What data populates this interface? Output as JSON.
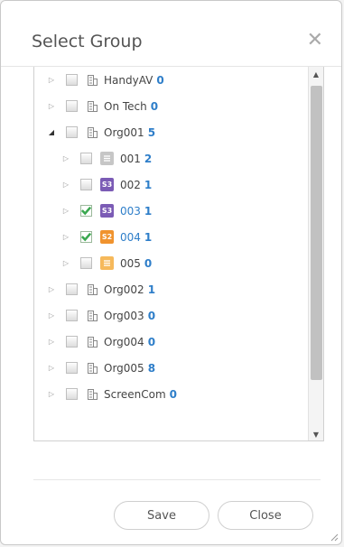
{
  "dialog": {
    "title": "Select Group",
    "close_icon": "close-icon"
  },
  "tree": [
    {
      "level": 0,
      "expanded": false,
      "checked": false,
      "icon": "building-icon",
      "name": "HandyAV",
      "count": "0"
    },
    {
      "level": 0,
      "expanded": false,
      "checked": false,
      "icon": "building-icon",
      "name": "On Tech",
      "count": "0"
    },
    {
      "level": 0,
      "expanded": true,
      "checked": false,
      "icon": "building-icon",
      "name": "Org001",
      "count": "5"
    },
    {
      "level": 1,
      "expanded": false,
      "checked": false,
      "icon": "list-icon",
      "badge": "",
      "badge_color": "gray",
      "name": "001",
      "count": "2"
    },
    {
      "level": 1,
      "expanded": false,
      "checked": false,
      "icon": "s3-badge-icon",
      "badge": "S3",
      "badge_color": "purple",
      "name": "002",
      "count": "1"
    },
    {
      "level": 1,
      "expanded": false,
      "checked": true,
      "icon": "s3-badge-icon",
      "badge": "S3",
      "badge_color": "purple",
      "name": "003",
      "count": "1"
    },
    {
      "level": 1,
      "expanded": false,
      "checked": true,
      "icon": "s2-badge-icon",
      "badge": "S2",
      "badge_color": "orange",
      "name": "004",
      "count": "1"
    },
    {
      "level": 1,
      "expanded": false,
      "checked": false,
      "icon": "list-icon",
      "badge": "",
      "badge_color": "yellow",
      "name": "005",
      "count": "0"
    },
    {
      "level": 0,
      "expanded": false,
      "checked": false,
      "icon": "building-icon",
      "name": "Org002",
      "count": "1"
    },
    {
      "level": 0,
      "expanded": false,
      "checked": false,
      "icon": "building-icon",
      "name": "Org003",
      "count": "0"
    },
    {
      "level": 0,
      "expanded": false,
      "checked": false,
      "icon": "building-icon",
      "name": "Org004",
      "count": "0"
    },
    {
      "level": 0,
      "expanded": false,
      "checked": false,
      "icon": "building-icon",
      "name": "Org005",
      "count": "8"
    },
    {
      "level": 0,
      "expanded": false,
      "checked": false,
      "icon": "building-icon",
      "name": "ScreenCom",
      "count": "0"
    }
  ],
  "footer": {
    "save_label": "Save",
    "close_label": "Close"
  },
  "colors": {
    "accent": "#2e7ec9",
    "check": "#3aa84f"
  }
}
